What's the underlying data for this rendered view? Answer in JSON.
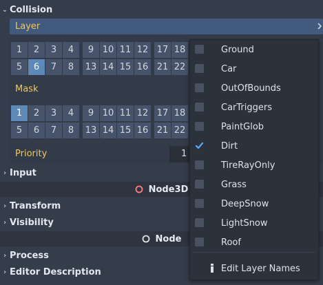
{
  "collision": {
    "section_title": "Collision",
    "layer_label": "Layer",
    "layer_row1": [
      "1",
      "2",
      "3",
      "4",
      "9",
      "10",
      "11",
      "12",
      "17",
      "18"
    ],
    "layer_row2": [
      "5",
      "6",
      "7",
      "8",
      "13",
      "14",
      "15",
      "16",
      "21",
      "22"
    ],
    "layer_selected": "6",
    "mask_label": "Mask",
    "mask_row1": [
      "1",
      "2",
      "3",
      "4",
      "9",
      "10",
      "11",
      "12",
      "17",
      "18"
    ],
    "mask_row2": [
      "5",
      "6",
      "7",
      "8",
      "13",
      "14",
      "15",
      "16",
      "21",
      "22"
    ],
    "mask_selected": "1",
    "priority_label": "Priority",
    "priority_value": "1"
  },
  "sections": {
    "input": "Input",
    "node3d": "Node3D",
    "transform": "Transform",
    "visibility": "Visibility",
    "node": "Node",
    "process": "Process",
    "editor_description": "Editor Description"
  },
  "popup": {
    "items": [
      {
        "label": "Ground",
        "checked": false
      },
      {
        "label": "Car",
        "checked": false
      },
      {
        "label": "OutOfBounds",
        "checked": false
      },
      {
        "label": "CarTriggers",
        "checked": false
      },
      {
        "label": "PaintGlob",
        "checked": false
      },
      {
        "label": "Dirt",
        "checked": true
      },
      {
        "label": "TireRayOnly",
        "checked": false
      },
      {
        "label": "Grass",
        "checked": false
      },
      {
        "label": "DeepSnow",
        "checked": false
      },
      {
        "label": "LightSnow",
        "checked": false
      },
      {
        "label": "Roof",
        "checked": false
      }
    ],
    "edit_label": "Edit Layer Names"
  },
  "colors": {
    "accent": "#f1c75b",
    "selected_cell": "#5c89b8",
    "check": "#5aa2e8",
    "node3d_icon": "#fc7f7f"
  }
}
